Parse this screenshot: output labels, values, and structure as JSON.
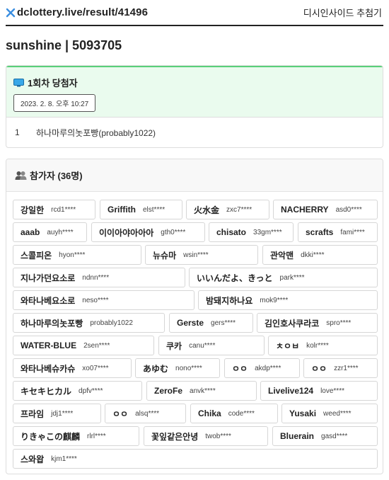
{
  "header": {
    "url": "dclottery.live/result/41496",
    "link": "디시인사이드 추첨기",
    "logo_icon": "x-icon"
  },
  "page_title": "sunshine | 5093705",
  "winners": {
    "title": "1회차 당첨자",
    "title_icon": "monitor-icon",
    "date": "2023. 2. 8. 오후 10:27",
    "list": [
      {
        "rank": "1",
        "name": "하나마루의놋포빵(probably1022)"
      }
    ],
    "accent_color": "#5ad07a"
  },
  "participants": {
    "title": "참가자 (36명)",
    "title_icon": "users-icon",
    "list": [
      {
        "name": "강일한",
        "id": "rcd1****"
      },
      {
        "name": "Griffith",
        "id": "elst****"
      },
      {
        "name": "火水金",
        "id": "zxc7****"
      },
      {
        "name": "NACHERRY",
        "id": "asd0****"
      },
      {
        "name": "aaab",
        "id": "auyh****"
      },
      {
        "name": "이이아야아아아",
        "id": "gth0****"
      },
      {
        "name": "chisato",
        "id": "33gm****"
      },
      {
        "name": "scrafts",
        "id": "fami****"
      },
      {
        "name": "스콜피온",
        "id": "hyon****"
      },
      {
        "name": "뉴슈마",
        "id": "wsin****"
      },
      {
        "name": "관악맨",
        "id": "dkki****"
      },
      {
        "name": "지나가던요소로",
        "id": "ndnn****"
      },
      {
        "name": "いいんだよ、きっと",
        "id": "park****"
      },
      {
        "name": "와타나베요소로",
        "id": "neso****"
      },
      {
        "name": "밤돼지하나요",
        "id": "mok9****"
      },
      {
        "name": "하나마루의놋포빵",
        "id": "probably1022"
      },
      {
        "name": "Gerste",
        "id": "gers****"
      },
      {
        "name": "김인호사쿠라코",
        "id": "spro****"
      },
      {
        "name": "WATER-BLUE",
        "id": "2sen****"
      },
      {
        "name": "쿠카",
        "id": "canu****"
      },
      {
        "name": "ㅊㅇㅂ",
        "id": "kolr****"
      },
      {
        "name": "와타나베슈카슈",
        "id": "xo07****"
      },
      {
        "name": "あゆむ",
        "id": "nono****"
      },
      {
        "name": "ㅇㅇ",
        "id": "akdp****"
      },
      {
        "name": "ㅇㅇ",
        "id": "zzr1****"
      },
      {
        "name": "キセキヒカル",
        "id": "dpfv****"
      },
      {
        "name": "ZeroFe",
        "id": "anvk****"
      },
      {
        "name": "Livelive124",
        "id": "love****"
      },
      {
        "name": "프라임",
        "id": "jdj1****"
      },
      {
        "name": "ㅇㅇ",
        "id": "alsq****"
      },
      {
        "name": "Chika",
        "id": "code****"
      },
      {
        "name": "Yusaki",
        "id": "weed****"
      },
      {
        "name": "りきゃこの麒麟",
        "id": "rlrl****"
      },
      {
        "name": "꽃잎같은안녕",
        "id": "twob****"
      },
      {
        "name": "Bluerain",
        "id": "gasd****"
      },
      {
        "name": "스와왑",
        "id": "kjm1****"
      }
    ]
  }
}
